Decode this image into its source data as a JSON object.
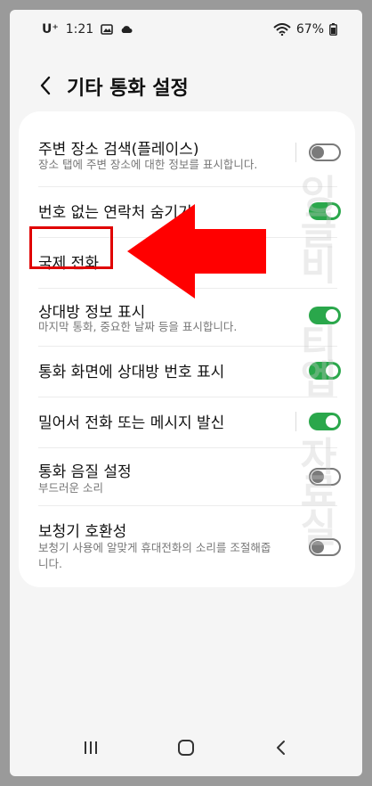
{
  "status_bar": {
    "carrier": "U⁺",
    "time": "1:21",
    "battery": "67%",
    "icons": [
      "gallery-icon",
      "cloud-icon",
      "wifi-icon",
      "battery-icon"
    ]
  },
  "header": {
    "title": "기타 통화 설정"
  },
  "settings": [
    {
      "label": "주변 장소 검색(플레이스)",
      "sub": "장소 탭에 주변 장소에 대한 정보를 표시합니다.",
      "toggle": false
    },
    {
      "label": "번호 없는 연락처 숨기기",
      "sub": "",
      "toggle": true
    },
    {
      "label": "국제 전화",
      "sub": "",
      "toggle": null
    },
    {
      "label": "상대방 정보 표시",
      "sub": "마지막 통화, 중요한 날짜 등을 표시합니다.",
      "toggle": true
    },
    {
      "label": "통화 화면에 상대방 번호 표시",
      "sub": "",
      "toggle": true
    },
    {
      "label": "밀어서 전화 또는 메시지 발신",
      "sub": "",
      "toggle": true
    },
    {
      "label": "통화 음질 설정",
      "sub": "부드러운 소리",
      "toggle": false
    },
    {
      "label": "보청기 호환성",
      "sub": "보청기 사용에 알맞게 휴대전화의 소리를 조절해줍니다.",
      "toggle": false
    }
  ],
  "watermark": "잉글비 티엡 자료실",
  "colors": {
    "toggle_on": "#2aa74b",
    "highlight": "#e00000",
    "arrow": "#ff0000"
  },
  "nav": {
    "icons": [
      "recents-icon",
      "home-icon",
      "back-icon"
    ]
  }
}
